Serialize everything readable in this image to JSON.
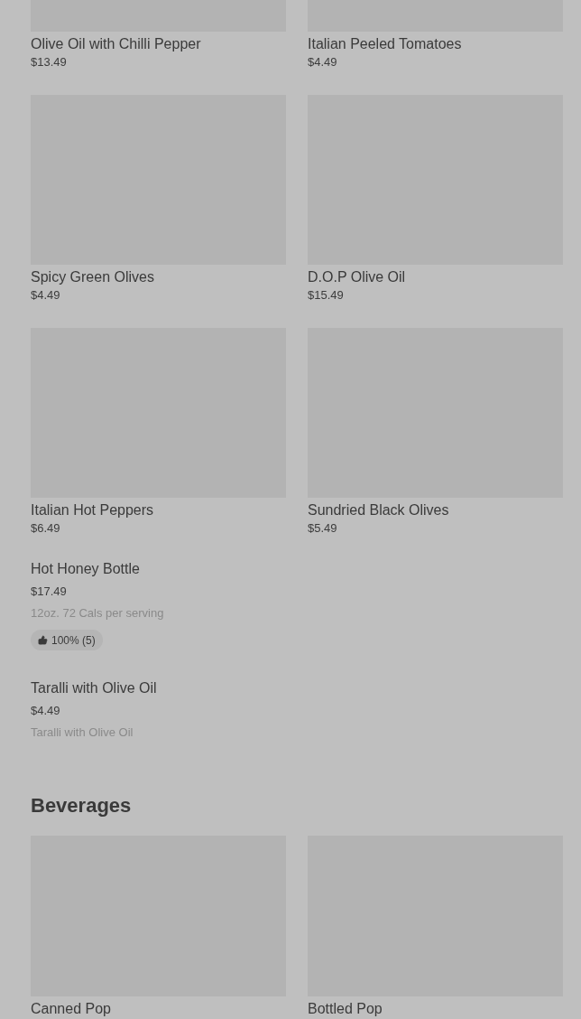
{
  "grid_items": [
    {
      "name": "Olive Oil with Chilli Pepper",
      "price": "$13.49"
    },
    {
      "name": "Italian Peeled Tomatoes",
      "price": "$4.49"
    },
    {
      "name": "Spicy Green Olives",
      "price": "$4.49"
    },
    {
      "name": "D.O.P Olive Oil",
      "price": "$15.49"
    },
    {
      "name": "Italian Hot Peppers",
      "price": "$6.49"
    },
    {
      "name": "Sundried Black Olives",
      "price": "$5.49"
    }
  ],
  "list_items": [
    {
      "name": "Hot Honey Bottle",
      "price": "$17.49",
      "description": "12oz. 72 Cals per serving",
      "rating": "100% (5)"
    },
    {
      "name": "Taralli with Olive Oil",
      "price": "$4.49",
      "description": "Taralli with Olive Oil"
    }
  ],
  "categories": [
    {
      "title": "Beverages",
      "items": [
        {
          "name": "Canned Pop"
        },
        {
          "name": "Bottled Pop"
        }
      ]
    }
  ]
}
